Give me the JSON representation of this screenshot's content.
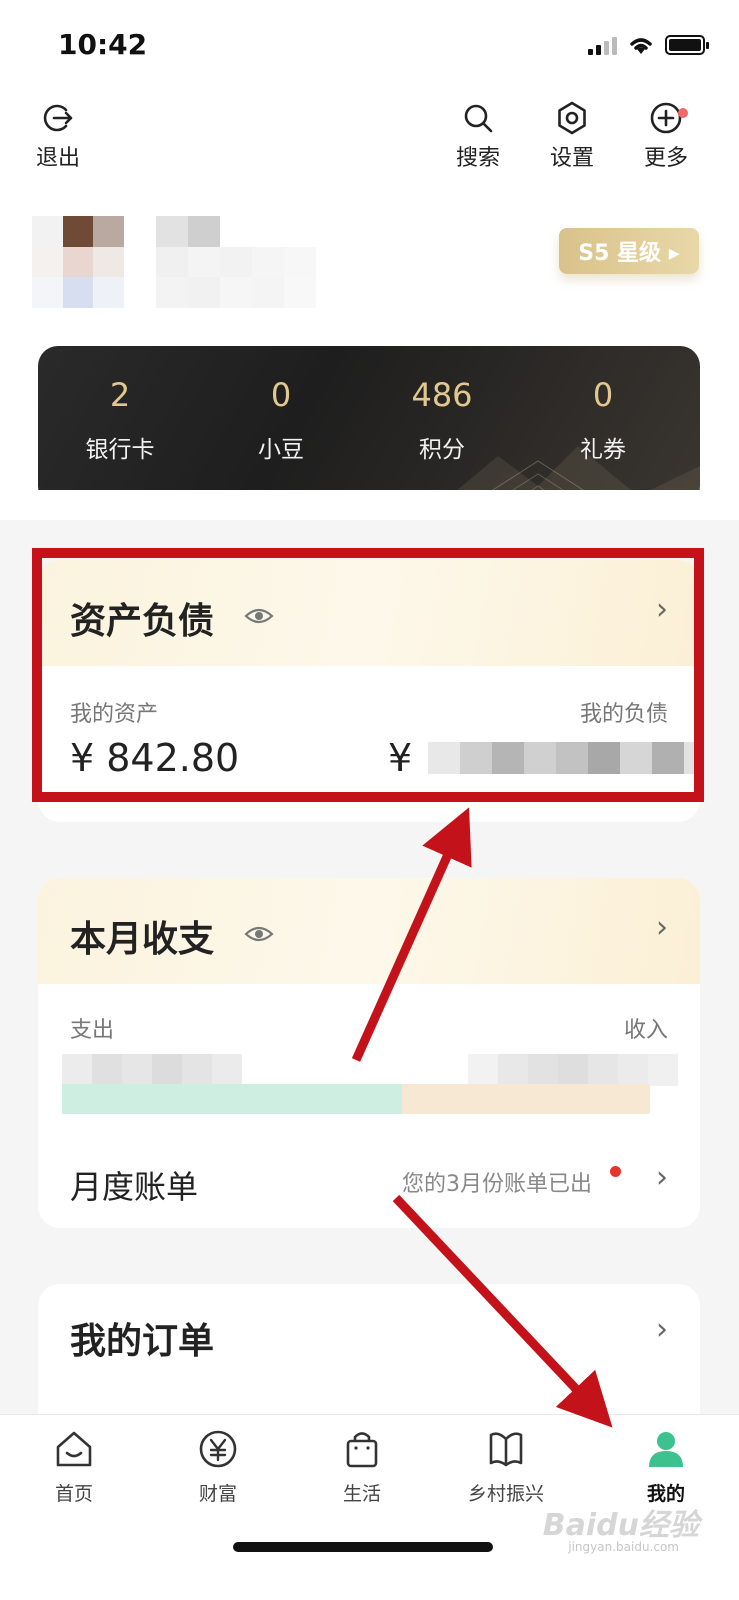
{
  "status_bar": {
    "time": "10:42"
  },
  "header": {
    "logout_label": "退出",
    "search_label": "搜索",
    "settings_label": "设置",
    "more_label": "更多"
  },
  "profile": {
    "level_badge": "S5 星级 ▸"
  },
  "stats": [
    {
      "value": "2",
      "label": "银行卡"
    },
    {
      "value": "0",
      "label": "小豆"
    },
    {
      "value": "486",
      "label": "积分"
    },
    {
      "value": "0",
      "label": "礼券"
    }
  ],
  "assets_card": {
    "title": "资产负债",
    "assets_label": "我的资产",
    "assets_value": "¥ 842.80",
    "liabilities_label": "我的负债",
    "liabilities_currency": "¥"
  },
  "monthly_card": {
    "title": "本月收支",
    "expense_label": "支出",
    "income_label": "收入",
    "bill_title": "月度账单",
    "bill_notice": "您的3月份账单已出"
  },
  "orders_card": {
    "title": "我的订单"
  },
  "bottom_nav": [
    {
      "label": "首页",
      "icon": "home-icon"
    },
    {
      "label": "财富",
      "icon": "yuan-icon"
    },
    {
      "label": "生活",
      "icon": "bag-icon"
    },
    {
      "label": "乡村振兴",
      "icon": "book-icon"
    },
    {
      "label": "我的",
      "icon": "person-icon"
    }
  ],
  "watermark": {
    "text": "Baidu经验",
    "sub": "jingyan.baidu.com"
  },
  "colors": {
    "accent_gold": "#e2c88e",
    "highlight_red": "#c4121b",
    "active_green": "#3cc18f",
    "notice_dot": "#e8322c"
  }
}
